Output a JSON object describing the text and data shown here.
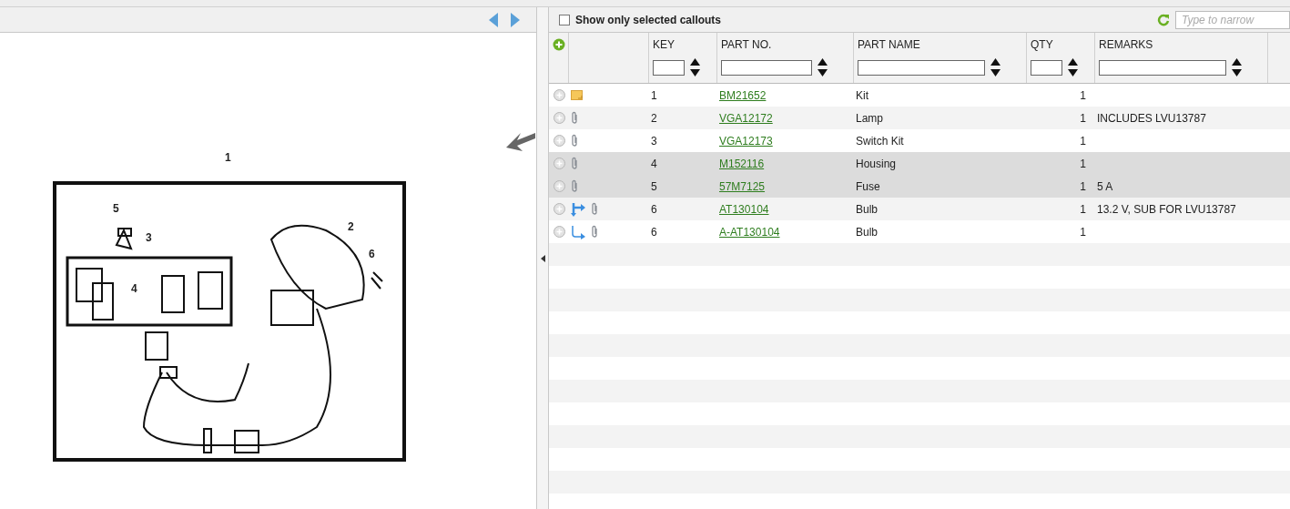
{
  "toolbar": {
    "filter_checkbox": {
      "label": "Show only selected callouts",
      "checked": false
    },
    "search": {
      "placeholder": "Type to narrow"
    }
  },
  "diagram": {
    "callouts": [
      "1",
      "2",
      "3",
      "4",
      "5",
      "6"
    ]
  },
  "table": {
    "columns": [
      "KEY",
      "PART NO.",
      "PART NAME",
      "QTY",
      "REMARKS"
    ],
    "rows": [
      {
        "kind": "note",
        "key": "1",
        "part_no": "BM21652",
        "part_name": "Kit",
        "qty": "1",
        "remarks": "",
        "selected": false
      },
      {
        "kind": "part",
        "key": "2",
        "part_no": "VGA12172",
        "part_name": "Lamp",
        "qty": "1",
        "remarks": "INCLUDES LVU13787",
        "selected": false
      },
      {
        "kind": "part",
        "key": "3",
        "part_no": "VGA12173",
        "part_name": "Switch Kit",
        "qty": "1",
        "remarks": "",
        "selected": false
      },
      {
        "kind": "part",
        "key": "4",
        "part_no": "M152116",
        "part_name": "Housing",
        "qty": "1",
        "remarks": "",
        "selected": true
      },
      {
        "kind": "part",
        "key": "5",
        "part_no": "57M7125",
        "part_name": "Fuse",
        "qty": "1",
        "remarks": "5 A",
        "selected": true
      },
      {
        "kind": "substitute",
        "key": "6",
        "part_no": "AT130104",
        "part_name": "Bulb",
        "qty": "1",
        "remarks": "13.2 V, SUB FOR LVU13787",
        "selected": false
      },
      {
        "kind": "alternate",
        "key": "6",
        "part_no": "A-AT130104",
        "part_name": "Bulb",
        "qty": "1",
        "remarks": "",
        "selected": false
      }
    ]
  }
}
